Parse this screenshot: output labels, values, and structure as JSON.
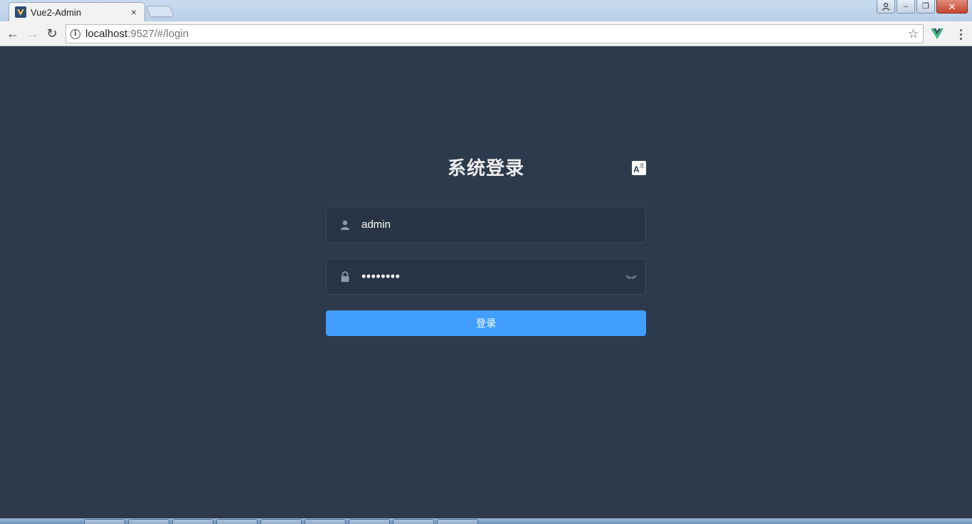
{
  "browser": {
    "tab_title": "Vue2-Admin",
    "tab_close": "×",
    "url_host": "localhost",
    "url_rest": ":9527/#/login",
    "info_icon": "i",
    "bookmark_icon": "☆",
    "back_icon": "←",
    "forward_icon": "→",
    "reload_icon": "↻",
    "window_controls": {
      "minimize": "–",
      "restore": "❐",
      "close": "✕"
    }
  },
  "login": {
    "title": "系统登录",
    "username": "admin",
    "password_masked": "••••••••",
    "submit_label": "登录"
  },
  "colors": {
    "page_bg": "#2d3a4b",
    "accent": "#409eff",
    "icon_gray": "#889aa4"
  }
}
